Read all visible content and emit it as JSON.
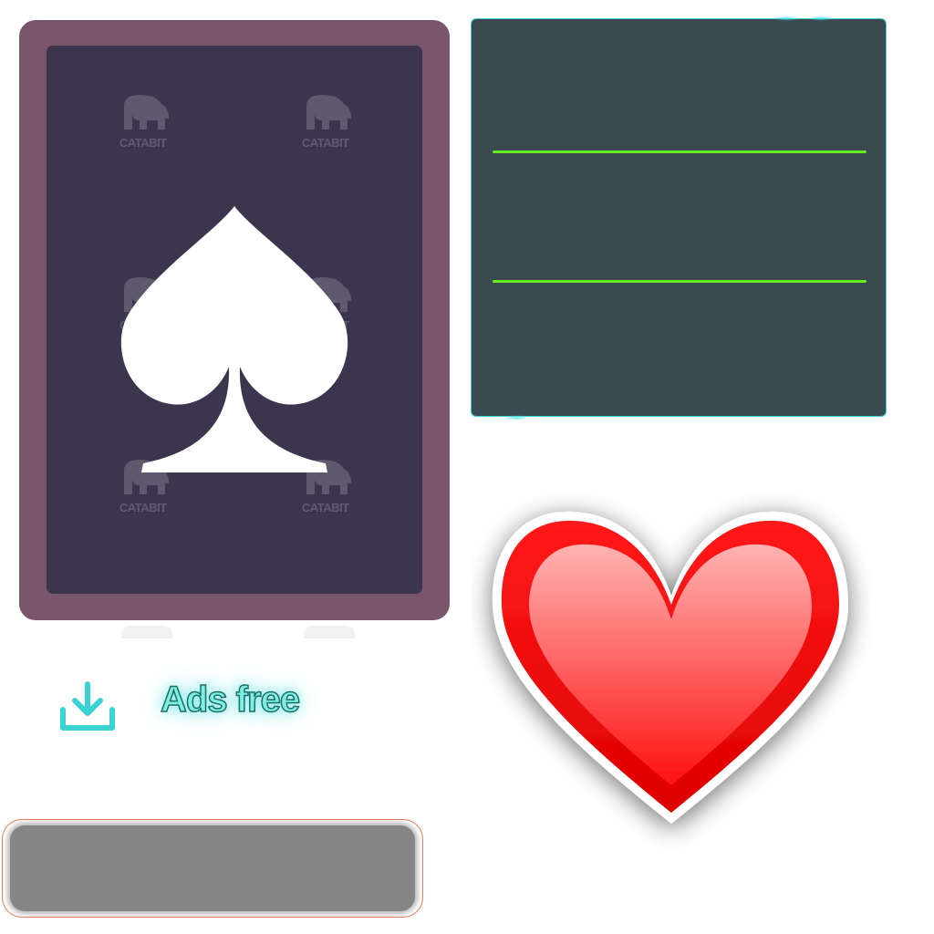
{
  "card_back": {
    "suit_icon": "spade-icon",
    "frame_color": "#79566b",
    "face_color": "#3d344e",
    "watermark_text": "CATABIT"
  },
  "panel": {
    "background": "#3a4a50",
    "border_color": "#3bd6d6",
    "line_color": "#66ee22"
  },
  "heart": {
    "icon": "heart-icon",
    "color": "#ff1a1a"
  },
  "ads_free": {
    "icon": "download-icon",
    "label": "Ads free",
    "accent": "#39d3d3"
  },
  "gray_bar": {
    "color": "#858585"
  }
}
